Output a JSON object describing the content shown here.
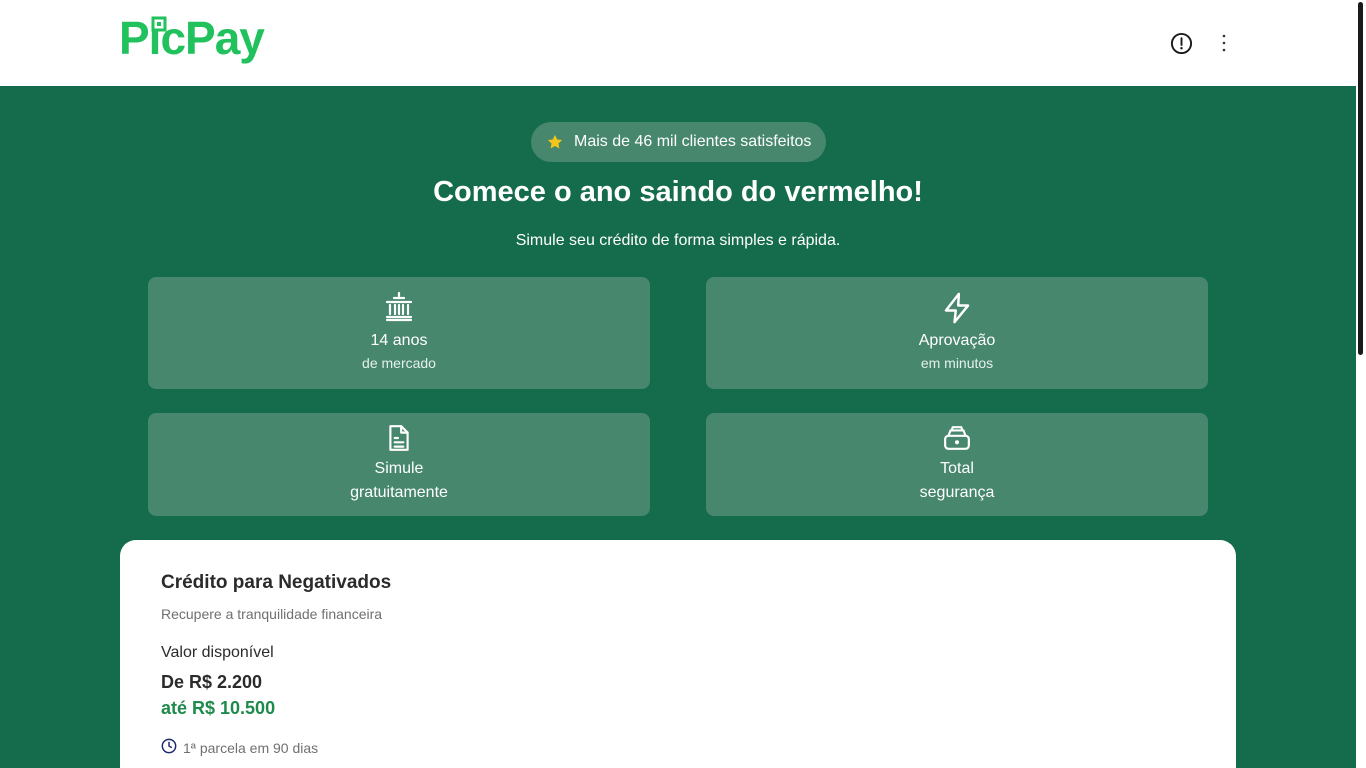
{
  "header": {
    "logo_text": "PicPay",
    "brand_color": "#21c25e",
    "alert_icon": "alert-circle-icon",
    "menu_icon": "more-vertical-icon"
  },
  "hero": {
    "rating_text": "Mais de 46 mil clientes satisfeitos",
    "rating_icon": "star-icon",
    "title": "Comece o ano saindo do vermelho!",
    "subtitle": "Simule seu crédito de forma simples e rápida."
  },
  "features": [
    {
      "icon": "bank-icon",
      "title": "14 anos",
      "subtitle": "de mercado"
    },
    {
      "icon": "lightning-icon",
      "title": "Aprovação",
      "subtitle": "em minutos"
    },
    {
      "icon": "document-icon",
      "title": "Simule",
      "subtitle": "gratuitamente"
    },
    {
      "icon": "safe-icon",
      "title": "Total",
      "subtitle": "segurança"
    }
  ],
  "offer": {
    "title": "Crédito para Negativados",
    "subtitle": "Recupere a tranquilidade financeira",
    "available_label": "Valor disponível",
    "range_from": "De R$ 2.200",
    "range_to": "até R$ 10.500",
    "installment_text": "1ª parcela em 90 dias",
    "installment_icon": "clock-icon"
  },
  "colors": {
    "background": "#146c4c",
    "card": "#46876d",
    "accent_green": "#1e8a4c",
    "star": "#f5c518"
  }
}
